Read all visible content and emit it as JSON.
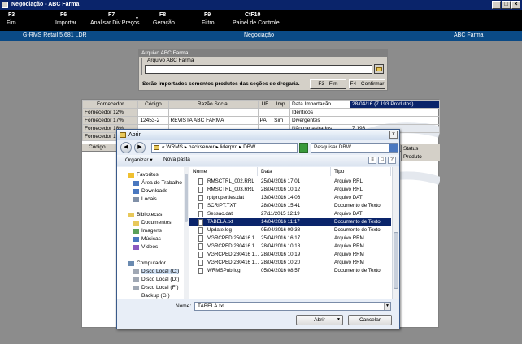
{
  "window": {
    "title": "Negociação - ABC Farma"
  },
  "fkeys": [
    {
      "key": "F3",
      "label": "Fim"
    },
    {
      "key": "F6",
      "label": "Importar"
    },
    {
      "key": "F7",
      "label": "Analisar Div.Preços"
    },
    {
      "key": "F8",
      "label": "Geração"
    },
    {
      "key": "F9",
      "label": "Filtro"
    },
    {
      "key": "CtF10",
      "label": "Painel de Controle"
    }
  ],
  "header": {
    "left": "G-RMS Retail 5.681 LDR",
    "center": "Negociação",
    "right": "ABC Farma"
  },
  "abc_dialog": {
    "title": "Arquivo ABC Farma",
    "group_label": "Arquivo ABC Farma",
    "file_value": "",
    "note": "Serão importados somentos produtos das seções de drogaria.",
    "btn_fim": "F3 - Fim",
    "btn_confirmar": "F4 - Confirmar"
  },
  "grid": {
    "headers": [
      "Fornecedor",
      "Código",
      "Razão Social",
      "UF",
      "Imp"
    ],
    "rows": [
      {
        "label": "Fornecedor 12%",
        "codigo": "",
        "razao": "",
        "uf": "",
        "imp": ""
      },
      {
        "label": "Fornecedor 17%",
        "codigo": "12453-2",
        "razao": "REVISTA ABC FARMA",
        "uf": "PA",
        "imp": "Sim"
      },
      {
        "label": "Fornecedor 18%",
        "codigo": "",
        "razao": "",
        "uf": "",
        "imp": ""
      },
      {
        "label": "Fornecedor 19%",
        "codigo": "",
        "razao": "",
        "uf": "",
        "imp": ""
      }
    ],
    "info": [
      {
        "label": "Data Importação",
        "value": "28/04/16 (7.193 Produtos)"
      },
      {
        "label": "Idênticos",
        "value": ""
      },
      {
        "label": "Divergentes",
        "value": ""
      },
      {
        "label": "Não cadastrados",
        "value": "7.193"
      }
    ],
    "lower_codigo": "Código",
    "status": "Status",
    "produto": "Produto"
  },
  "open_dialog": {
    "title": "Abrir",
    "close": "x",
    "address": "« WRMS ▸ backserver ▸ liderprd ▸ DBW",
    "search_placeholder": "Pesquisar DBW",
    "organize": "Organizar ▾",
    "new_folder": "Nova pasta",
    "nav": {
      "favorites": "Favoritos",
      "desktop": "Área de Trabalho",
      "downloads": "Downloads",
      "locais": "Locais",
      "libraries": "Bibliotecas",
      "documentos": "Documentos",
      "imagens": "Imagens",
      "musicas": "Músicas",
      "videos": "Vídeos",
      "computer": "Computador",
      "disk_c": "Disco Local (C:)",
      "disk_d": "Disco Local (D:)",
      "disk_f": "Disco Local (F:)",
      "backup": "Backup (G:)"
    },
    "columns": {
      "name": "Nome",
      "date": "Data",
      "type": "Tipo"
    },
    "files": [
      {
        "name": "RMSCTRL_002.RRL",
        "date": "25/04/2016 17:01",
        "type": "Arquivo RRL"
      },
      {
        "name": "RMSCTRL_003.RRL",
        "date": "28/04/2016 10:12",
        "type": "Arquivo RRL"
      },
      {
        "name": "rptproperties.dat",
        "date": "13/04/2016 14:06",
        "type": "Arquivo DAT"
      },
      {
        "name": "SCRIPT.TXT",
        "date": "28/04/2016 15:41",
        "type": "Documento de Texto"
      },
      {
        "name": "Sessao.dat",
        "date": "27/11/2015 12:19",
        "type": "Arquivo DAT"
      },
      {
        "name": "TABELA.txt",
        "date": "14/04/2016 11:17",
        "type": "Documento de Texto"
      },
      {
        "name": "Update.log",
        "date": "05/04/2016 09:38",
        "type": "Documento de Texto"
      },
      {
        "name": "VGRCPED 250416 1...",
        "date": "25/04/2016 16:17",
        "type": "Arquivo RRM"
      },
      {
        "name": "VGRCPED 280416 1...",
        "date": "28/04/2016 10:18",
        "type": "Arquivo RRM"
      },
      {
        "name": "VGRCPED 280416 1...",
        "date": "28/04/2016 10:19",
        "type": "Arquivo RRM"
      },
      {
        "name": "VGRCPED 280416 1...",
        "date": "28/04/2016 10:20",
        "type": "Arquivo RRM"
      },
      {
        "name": "WRMSPub.log",
        "date": "05/04/2016 08:57",
        "type": "Documento de Texto"
      }
    ],
    "filename_label": "Nome:",
    "filename_value": "TABELA.txt",
    "open_btn": "Abrir",
    "cancel_btn": "Cancelar"
  }
}
